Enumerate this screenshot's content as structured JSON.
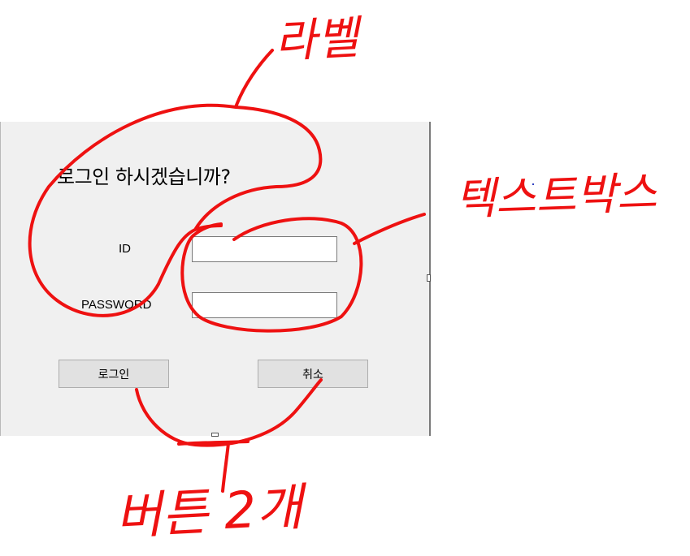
{
  "form": {
    "title": "로그인 하시겠습니까?",
    "id_label": "ID",
    "password_label": "PASSWORD",
    "id_value": "",
    "password_value": "",
    "login_button": "로그인",
    "cancel_button": "취소"
  },
  "annotations": {
    "label_note": "라벨",
    "textbox_note": "텍스트박스",
    "buttons_note": "버튼 2개",
    "color": "#ee1111"
  }
}
